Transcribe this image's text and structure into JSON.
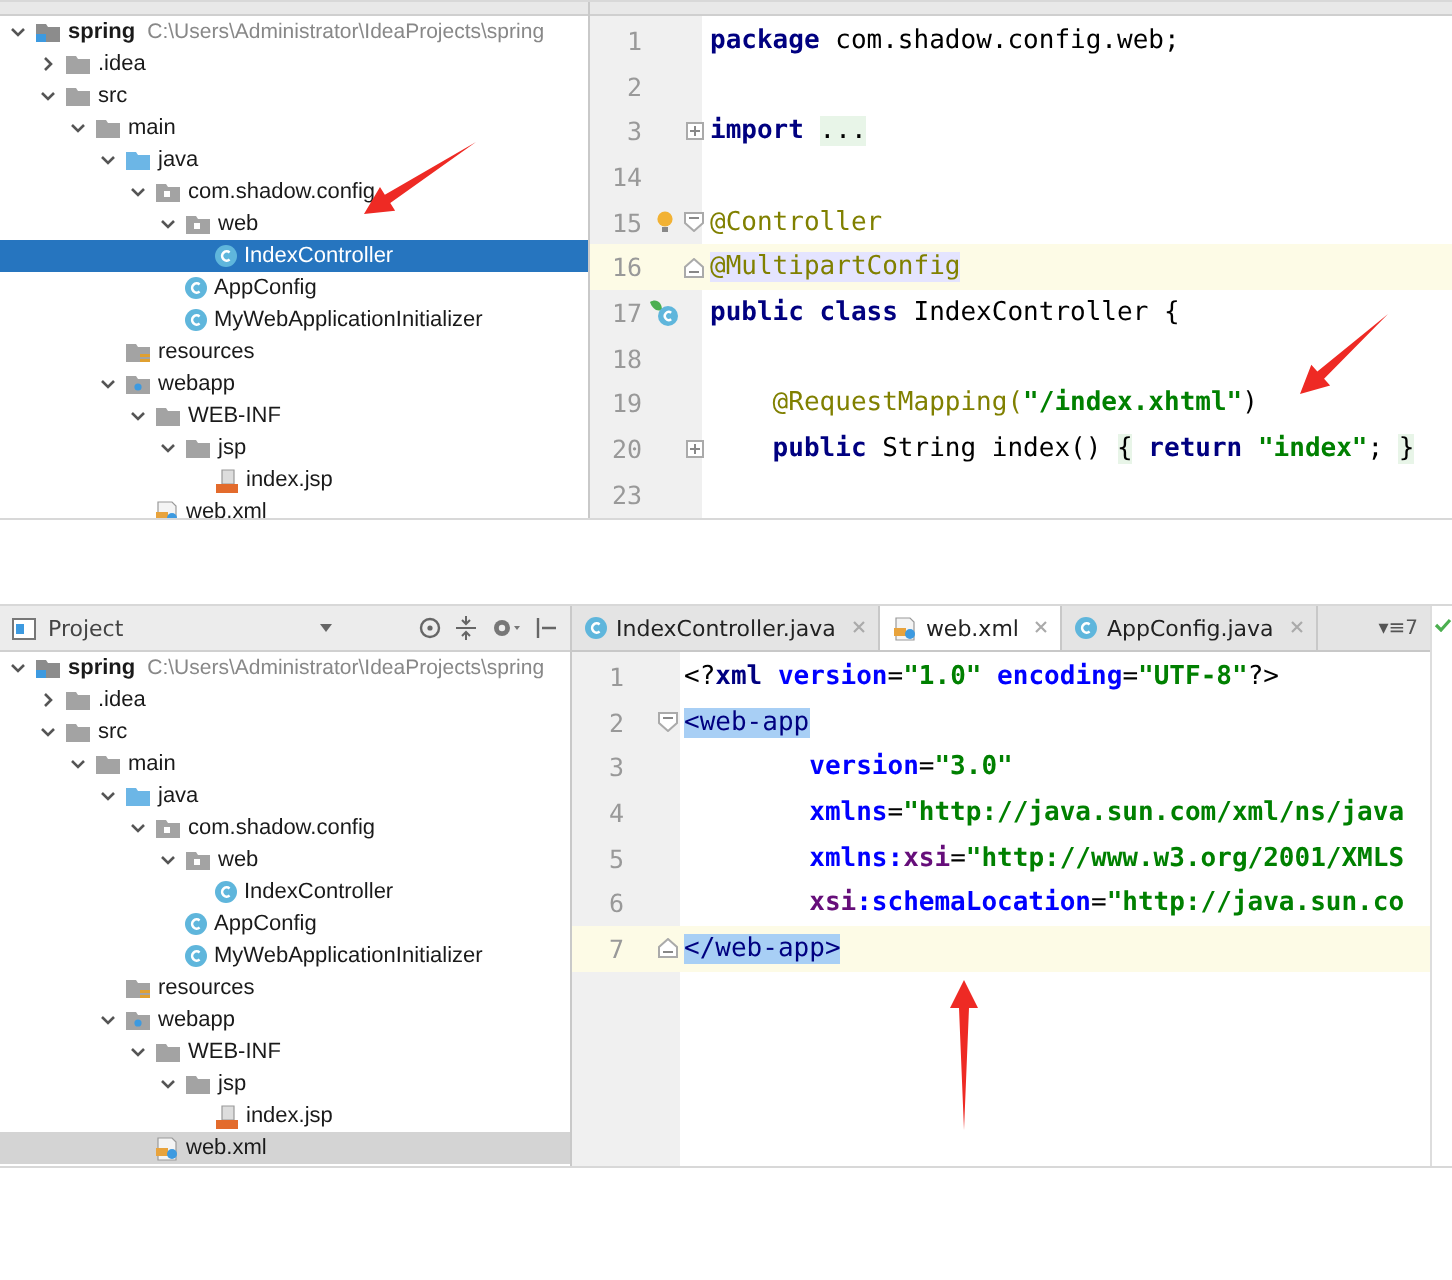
{
  "panels": [
    {
      "tree": {
        "items": [
          {
            "label": "spring",
            "kind": "module",
            "path": "C:\\Users\\Administrator\\IdeaProjects\\spring",
            "expanded": true,
            "selected": false,
            "children": [
              {
                "label": ".idea",
                "kind": "folder",
                "expanded": false,
                "selected": false
              },
              {
                "label": "src",
                "kind": "folder",
                "expanded": true,
                "selected": false,
                "children": [
                  {
                    "label": "main",
                    "kind": "folder",
                    "expanded": true,
                    "selected": false,
                    "children": [
                      {
                        "label": "java",
                        "kind": "source",
                        "expanded": true,
                        "selected": false,
                        "children": [
                          {
                            "label": "com.shadow.config",
                            "kind": "package",
                            "expanded": true,
                            "selected": false,
                            "children": [
                              {
                                "label": "web",
                                "kind": "package",
                                "expanded": true,
                                "selected": false,
                                "children": [
                                  {
                                    "label": "IndexController",
                                    "kind": "class",
                                    "selected": true
                                  }
                                ]
                              },
                              {
                                "label": "AppConfig",
                                "kind": "class",
                                "selected": false
                              },
                              {
                                "label": "MyWebApplicationInitializer",
                                "kind": "class",
                                "selected": false
                              }
                            ]
                          }
                        ]
                      },
                      {
                        "label": "resources",
                        "kind": "resources",
                        "selected": false
                      },
                      {
                        "label": "webapp",
                        "kind": "web",
                        "expanded": true,
                        "selected": false,
                        "children": [
                          {
                            "label": "WEB-INF",
                            "kind": "folder",
                            "expanded": true,
                            "selected": false,
                            "children": [
                              {
                                "label": "jsp",
                                "kind": "folder",
                                "expanded": true,
                                "selected": false,
                                "children": [
                                  {
                                    "label": "index.jsp",
                                    "kind": "jsp",
                                    "selected": false
                                  }
                                ]
                              }
                            ]
                          },
                          {
                            "label": "web.xml",
                            "kind": "xml",
                            "selected": false
                          }
                        ]
                      }
                    ]
                  }
                ]
              }
            ]
          }
        ]
      },
      "editor": {
        "lines": [
          {
            "number": "1",
            "tokens": [
              {
                "text": "package",
                "kind": "keyword"
              },
              {
                "text": " com.shadow.config.web;",
                "kind": "plain"
              }
            ]
          },
          {
            "number": "2"
          },
          {
            "number": "3",
            "fold": {
              "kind": "plus"
            },
            "tokens": [
              {
                "text": "import ",
                "kind": "keyword"
              },
              {
                "text": "...",
                "kind": "folded"
              }
            ]
          },
          {
            "number": "14"
          },
          {
            "number": "15",
            "fold": {
              "kind": "open"
            },
            "marker": {
              "kind": "bulb"
            },
            "tokens": [
              {
                "text": "@Controller",
                "kind": "annotation"
              }
            ]
          },
          {
            "number": "16",
            "fold": {
              "kind": "close"
            },
            "current": true,
            "tokens": [
              {
                "text": "@MultipartConfig",
                "kind": "annotation-hl"
              }
            ]
          },
          {
            "number": "17",
            "marker": {
              "kind": "class"
            },
            "tokens": [
              {
                "text": "public class",
                "kind": "keyword"
              },
              {
                "text": " IndexController {",
                "kind": "plain"
              }
            ]
          },
          {
            "number": "18"
          },
          {
            "number": "19",
            "tokens": [
              {
                "text": "    @RequestMapping(",
                "kind": "annotation"
              },
              {
                "text": "\"/index.xhtml\"",
                "kind": "string"
              },
              {
                "text": ")",
                "kind": "plain"
              }
            ]
          },
          {
            "number": "20",
            "fold": {
              "kind": "plus"
            },
            "tokens": [
              {
                "text": "    public",
                "kind": "keyword"
              },
              {
                "text": " String index() ",
                "kind": "plain"
              },
              {
                "text": "{",
                "kind": "folded"
              },
              {
                "text": " return ",
                "kind": "keyword"
              },
              {
                "text": "\"index\"",
                "kind": "string"
              },
              {
                "text": "; ",
                "kind": "plain"
              },
              {
                "text": "}",
                "kind": "folded"
              }
            ]
          },
          {
            "number": "23"
          }
        ]
      }
    },
    {
      "tree": {
        "header": {
          "title": "Project"
        },
        "items": [
          {
            "label": "spring",
            "kind": "module",
            "path": "C:\\Users\\Administrator\\IdeaProjects\\spring",
            "expanded": true,
            "selected": false,
            "children": [
              {
                "label": ".idea",
                "kind": "folder",
                "expanded": false,
                "selected": false
              },
              {
                "label": "src",
                "kind": "folder",
                "expanded": true,
                "selected": false,
                "children": [
                  {
                    "label": "main",
                    "kind": "folder",
                    "expanded": true,
                    "selected": false,
                    "children": [
                      {
                        "label": "java",
                        "kind": "source",
                        "expanded": true,
                        "selected": false,
                        "children": [
                          {
                            "label": "com.shadow.config",
                            "kind": "package",
                            "expanded": true,
                            "selected": false,
                            "children": [
                              {
                                "label": "web",
                                "kind": "package",
                                "expanded": true,
                                "selected": false,
                                "children": [
                                  {
                                    "label": "IndexController",
                                    "kind": "class",
                                    "selected": false
                                  }
                                ]
                              },
                              {
                                "label": "AppConfig",
                                "kind": "class",
                                "selected": false
                              },
                              {
                                "label": "MyWebApplicationInitializer",
                                "kind": "class",
                                "selected": false
                              }
                            ]
                          }
                        ]
                      },
                      {
                        "label": "resources",
                        "kind": "resources",
                        "selected": false
                      },
                      {
                        "label": "webapp",
                        "kind": "web",
                        "expanded": true,
                        "selected": false,
                        "children": [
                          {
                            "label": "WEB-INF",
                            "kind": "folder",
                            "expanded": true,
                            "selected": false,
                            "children": [
                              {
                                "label": "jsp",
                                "kind": "folder",
                                "expanded": true,
                                "selected": false,
                                "children": [
                                  {
                                    "label": "index.jsp",
                                    "kind": "jsp",
                                    "selected": false
                                  }
                                ]
                              }
                            ]
                          },
                          {
                            "label": "web.xml",
                            "kind": "xml",
                            "selected": true
                          }
                        ]
                      }
                    ]
                  }
                ]
              }
            ]
          }
        ]
      },
      "editor": {
        "tabs": [
          {
            "label": "IndexController.java",
            "kind": "class",
            "selected": false
          },
          {
            "label": "web.xml",
            "kind": "xml",
            "selected": true
          },
          {
            "label": "AppConfig.java",
            "kind": "class",
            "selected": false
          }
        ],
        "tab_menu": "▾≡7",
        "lines": [
          {
            "number": "1",
            "tokens": [
              {
                "text": "<?",
                "kind": "plain"
              },
              {
                "text": "xml",
                "kind": "tag"
              },
              {
                "text": " version",
                "kind": "attr"
              },
              {
                "text": "=",
                "kind": "plain"
              },
              {
                "text": "\"1.0\"",
                "kind": "string"
              },
              {
                "text": " encoding",
                "kind": "attr"
              },
              {
                "text": "=",
                "kind": "plain"
              },
              {
                "text": "\"UTF-8\"",
                "kind": "string"
              },
              {
                "text": "?>",
                "kind": "plain"
              }
            ]
          },
          {
            "number": "2",
            "fold": {
              "kind": "open"
            },
            "tokens": [
              {
                "text": "<web-app",
                "kind": "tag-match"
              }
            ]
          },
          {
            "number": "3",
            "tokens": [
              {
                "text": "        version",
                "kind": "attr"
              },
              {
                "text": "=",
                "kind": "plain"
              },
              {
                "text": "\"3.0\"",
                "kind": "string"
              }
            ]
          },
          {
            "number": "4",
            "tokens": [
              {
                "text": "        xmlns",
                "kind": "attr"
              },
              {
                "text": "=",
                "kind": "plain"
              },
              {
                "text": "\"http://java.sun.com/xml/ns/java",
                "kind": "string"
              }
            ]
          },
          {
            "number": "5",
            "tokens": [
              {
                "text": "        xmlns:",
                "kind": "attr"
              },
              {
                "text": "xsi",
                "kind": "attrns"
              },
              {
                "text": "=",
                "kind": "plain"
              },
              {
                "text": "\"http://www.w3.org/2001/XMLS",
                "kind": "string"
              }
            ]
          },
          {
            "number": "6",
            "tokens": [
              {
                "text": "        xsi",
                "kind": "attrns"
              },
              {
                "text": ":schemaLocation",
                "kind": "attr"
              },
              {
                "text": "=",
                "kind": "plain"
              },
              {
                "text": "\"http://java.sun.co",
                "kind": "string"
              }
            ]
          },
          {
            "number": "7",
            "fold": {
              "kind": "close"
            },
            "current": true,
            "tokens": [
              {
                "text": "</web-app>",
                "kind": "tag-match"
              }
            ]
          }
        ]
      }
    }
  ]
}
